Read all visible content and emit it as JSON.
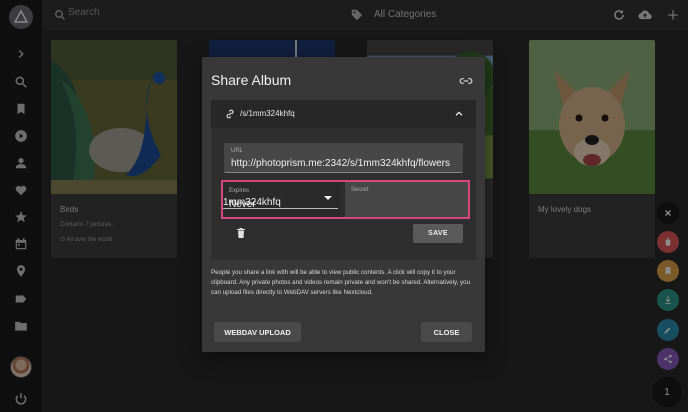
{
  "topbar": {
    "search_placeholder": "Search",
    "category_label": "All Categories"
  },
  "cards": [
    {
      "title": "Birds",
      "meta": "Contains 7 pictures.",
      "location": "All over the world"
    },
    {
      "title": "My lovely dogs"
    }
  ],
  "dialog": {
    "title": "Share Album",
    "link_path": "/s/1mm324khfq",
    "url_label": "URL",
    "url_value": "http://photoprism.me:2342/s/1mm324khfq/flowers",
    "expires_label": "Expires",
    "expires_value": "Never",
    "secret_label": "Secret",
    "secret_value": "1mm324khfq",
    "save_label": "SAVE",
    "description": "People you share a link with will be able to view public contents. A click will copy it to your clipboard. Any private photos and videos remain private and won't be shared. Alternatively, you can upload files directly to WebDAV servers like Nextcloud.",
    "webdav_label": "WEBDAV UPLOAD",
    "close_label": "CLOSE",
    "highlight_color": "#d9467f"
  },
  "fab": {
    "count": "1",
    "colors": {
      "delete": "#e05a5a",
      "album": "#e0a24a",
      "download": "#2e9a8a",
      "edit": "#2a8fb0",
      "share": "#8a5bc0"
    }
  },
  "icons": [
    "menu-icon",
    "search-icon",
    "bookmark-icon",
    "play-icon",
    "person-icon",
    "heart-icon",
    "star-icon",
    "calendar-icon",
    "place-icon",
    "label-icon",
    "folder-icon",
    "power-icon"
  ]
}
